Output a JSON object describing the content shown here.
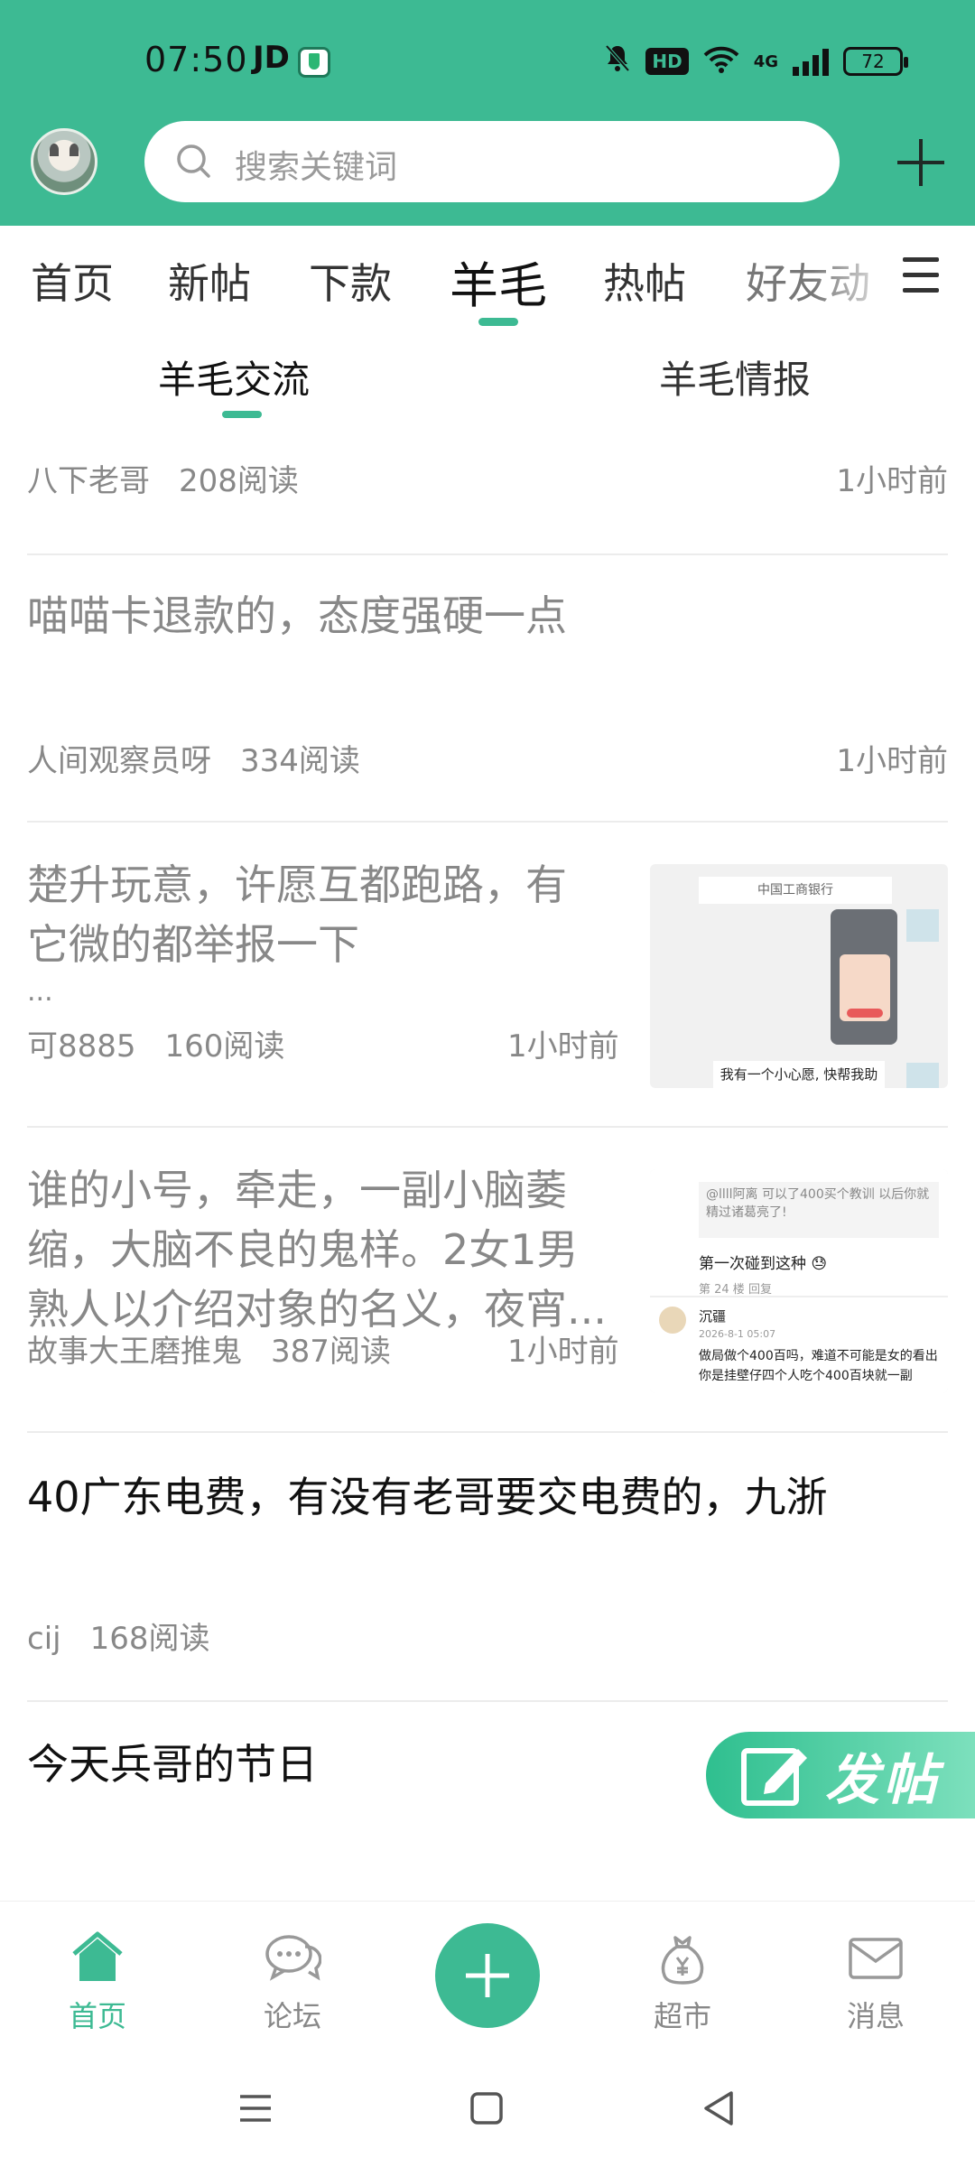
{
  "status_bar": {
    "time": "07:50",
    "carrier": "JD",
    "hd": "HD",
    "network": "4G",
    "battery": "72"
  },
  "header": {
    "search_placeholder": "搜索关键词",
    "accent_color": "#3dba93"
  },
  "category_tabs": [
    {
      "label": "首页",
      "active": false
    },
    {
      "label": "新帖",
      "active": false
    },
    {
      "label": "下款",
      "active": false
    },
    {
      "label": "羊毛",
      "active": true
    },
    {
      "label": "热帖",
      "active": false
    },
    {
      "label": "好友动",
      "active": false
    }
  ],
  "sub_tabs": [
    {
      "label": "羊毛交流",
      "active": true
    },
    {
      "label": "羊毛情报",
      "active": false
    }
  ],
  "posts": [
    {
      "title": "八下老哥",
      "author": "八下老哥",
      "reads": "208阅读",
      "time": "1小时前"
    },
    {
      "title": "喵喵卡退款的，态度强硬一点",
      "author": "人间观察员呀",
      "reads": "334阅读",
      "time": "1小时前"
    },
    {
      "title": "楚升玩意，许愿互都跑路，有它微的都举报一下",
      "title_line1": "楚升玩意，许愿互都跑路，有",
      "title_line2": "它微的都举报一下",
      "ellipsis": "...",
      "author": "可8885",
      "reads": "160阅读",
      "time": "1小时前",
      "thumb": {
        "top_text": "中国工商银行",
        "bubble_text": "我有一个小心愿, 快帮我助力!"
      }
    },
    {
      "title_line1": "谁的小号，牵走，一副小脑萎",
      "title_line2": "缩，大脑不良的鬼样。2女1男",
      "title_line3": "熟人以介绍对象的名义，夜宵...",
      "author": "故事大王磨推鬼",
      "reads": "387阅读",
      "time": "1小时前",
      "thumb": {
        "quote": "@llll阿离 可以了400买个教训 以后你就精过诸葛亮了!",
        "line": "第一次碰到这种 😓",
        "small": "第 24 楼   回复",
        "name": "沉疆",
        "date": "2026-8-1 05:07",
        "body": "做局做个400百吗，难道不可能是女的看出你是挂壁仔四个人吃个400百块就一副"
      }
    },
    {
      "title": "40广东电费，有没有老哥要交电费的，九浙",
      "author": "cij",
      "reads": "168阅读"
    },
    {
      "title": "今天兵哥的节日"
    }
  ],
  "fab": {
    "label": "发帖"
  },
  "bottom_nav": [
    {
      "label": "首页",
      "icon": "home-icon",
      "active": true
    },
    {
      "label": "论坛",
      "icon": "chat-icon",
      "active": false
    },
    {
      "label": "超市",
      "icon": "money-bag-icon",
      "active": false
    },
    {
      "label": "消息",
      "icon": "mail-icon",
      "active": false
    }
  ]
}
